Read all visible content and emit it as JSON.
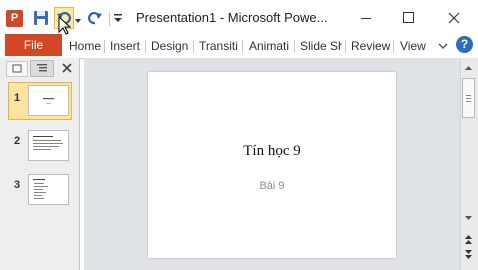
{
  "window": {
    "title": "Presentation1  -  Microsoft Powe...",
    "app_logo_letter": "P"
  },
  "quick_access": {
    "icons": [
      "save-icon",
      "undo-icon",
      "dropdown-icon",
      "redo-icon",
      "customize-icon"
    ]
  },
  "window_controls": [
    "minimize-icon",
    "maximize-icon",
    "close-icon"
  ],
  "ribbon": {
    "file_label": "File",
    "tabs": [
      "Home",
      "Insert",
      "Design",
      "Transiti",
      "Animati",
      "Slide Sh",
      "Review",
      "View"
    ],
    "help_label": "?"
  },
  "slides_pane": {
    "slides": [
      {
        "number": "1"
      },
      {
        "number": "2"
      },
      {
        "number": "3"
      }
    ],
    "selected_slide": 1
  },
  "slide": {
    "title": "Tín  học 9",
    "subtitle": "Bài 9"
  },
  "colors": {
    "file_tab": "#d24726",
    "selection_highlight": "#fbe3a0",
    "workspace": "#dfe3e8",
    "help_icon": "#2a6ebd"
  }
}
